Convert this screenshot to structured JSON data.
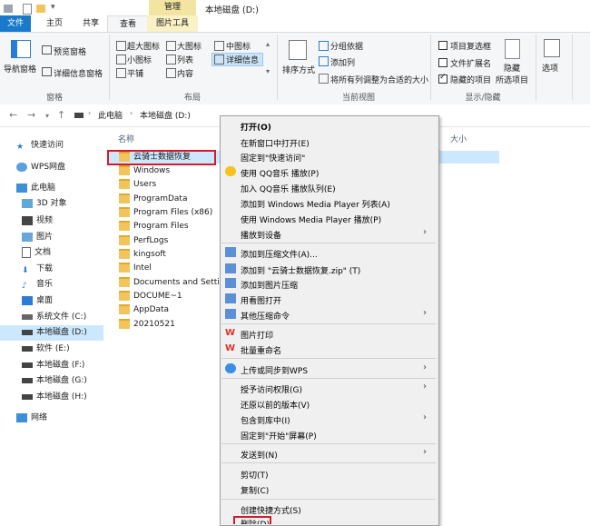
{
  "title_bar": {
    "tab_manage": "管理",
    "window_title": "本地磁盘 (D:)"
  },
  "ribbon_tabs": {
    "file": "文件",
    "home": "主页",
    "share": "共享",
    "view": "查看",
    "picture_tools": "图片工具"
  },
  "ribbon": {
    "nav_pane": "导航窗格",
    "preview_pane": "预览窗格",
    "details_pane": "详细信息窗格",
    "group_pane": "窗格",
    "xl_icons": "超大图标",
    "large_icons": "大图标",
    "medium_icons": "中图标",
    "small_icons": "小图标",
    "list": "列表",
    "details": "详细信息",
    "tiles": "平铺",
    "content": "内容",
    "group_layout": "布局",
    "sort_by": "排序方式",
    "group_by": "分组依据",
    "add_columns": "添加列",
    "size_columns": "将所有列调整为合适的大小",
    "group_current_view": "当前视图",
    "item_checkboxes": "项目复选框",
    "file_extensions": "文件扩展名",
    "hidden_items": "隐藏的项目",
    "hide": "隐藏",
    "selected_items": "所选项目",
    "group_show_hide": "显示/隐藏",
    "options": "选项"
  },
  "address": {
    "pc": "此电脑",
    "drive": "本地磁盘 (D:)"
  },
  "nav_pane": {
    "items": [
      {
        "label": "快速访问"
      },
      {
        "label": "WPS网盘"
      },
      {
        "label": "此电脑"
      },
      {
        "label": "3D 对象"
      },
      {
        "label": "视频"
      },
      {
        "label": "图片"
      },
      {
        "label": "文档"
      },
      {
        "label": "下载"
      },
      {
        "label": "音乐"
      },
      {
        "label": "桌面"
      },
      {
        "label": "系统文件 (C:)"
      },
      {
        "label": "本地磁盘 (D:)"
      },
      {
        "label": "软件 (E:)"
      },
      {
        "label": "本地磁盘 (F:)"
      },
      {
        "label": "本地磁盘 (G:)"
      },
      {
        "label": "本地磁盘 (H:)"
      },
      {
        "label": "网络"
      }
    ]
  },
  "file_list": {
    "col_name": "名称",
    "col_size": "大小",
    "rows": [
      "云骑士数据恢复",
      "Windows",
      "Users",
      "ProgramData",
      "Program Files (x86)",
      "Program Files",
      "PerfLogs",
      "kingsoft",
      "Intel",
      "Documents and Settings",
      "DOCUME~1",
      "AppData",
      "20210521"
    ]
  },
  "context_menu": {
    "items": [
      "打开(O)",
      "在新窗口中打开(E)",
      "固定到\"快速访问\"",
      "使用 QQ音乐 播放(P)",
      "加入 QQ音乐 播放队列(E)",
      "添加到 Windows Media Player 列表(A)",
      "使用 Windows Media Player 播放(P)",
      "播放到设备",
      "添加到压缩文件(A)...",
      "添加到 \"云骑士数据恢复.zip\" (T)",
      "添加到图片压缩",
      "用看图打开",
      "其他压缩命令",
      "图片打印",
      "批量重命名",
      "上传或同步到WPS",
      "授予访问权限(G)",
      "还原以前的版本(V)",
      "包含到库中(I)",
      "固定到\"开始\"屏幕(P)",
      "发送到(N)",
      "剪切(T)",
      "复制(C)",
      "创建快捷方式(S)",
      "删除(D)"
    ]
  },
  "colors": {
    "accent": "#1979ca",
    "selection": "#cce8ff",
    "highlight_border": "#d21c2d",
    "folder": "#f2c55c"
  }
}
